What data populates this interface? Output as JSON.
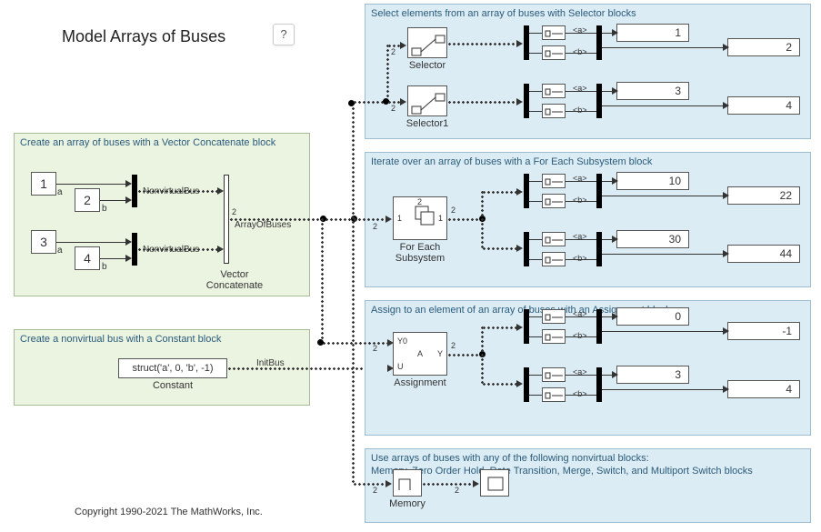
{
  "title": "Model Arrays of Buses",
  "help_label": "?",
  "areas": {
    "create_array": "Create an array of buses with a Vector Concatenate block",
    "create_bus": "Create a nonvirtual bus with a Constant block",
    "select": "Select elements from an array of buses with Selector blocks",
    "iterate": "Iterate over an array of buses with a For Each Subsystem block",
    "assign": "Assign to an element of an array of buses with an Assignment block",
    "other": "Use arrays of buses with any of the following nonvirtual blocks:\nMemory, Zero Order Hold, Rate Transition, Merge, Switch, and Multiport Switch blocks"
  },
  "constants": {
    "c1": "1",
    "c2": "2",
    "c3": "3",
    "c4": "4"
  },
  "port_a": "a",
  "port_b": "b",
  "bus_label_nv": "NonvirtualBus",
  "signal_array": "ArrayOfBuses",
  "signal_init": "InitBus",
  "vec_concat_label": "Vector\nConcatenate",
  "constant_expr": "struct('a', 0, 'b', -1)",
  "constant_label": "Constant",
  "selector_label": "Selector",
  "selector1_label": "Selector1",
  "foreach_label": "For Each\nSubsystem",
  "assignment_label": "Assignment",
  "assignment_ports": {
    "y0": "Y0",
    "u": "U",
    "y": "Y",
    "a": "A"
  },
  "memory_label": "Memory",
  "bus_sel_a": "<a>",
  "bus_sel_b": "<b>",
  "dim1": "1",
  "dim2": "2",
  "displays": {
    "sel": {
      "a": "1",
      "b": "2",
      "a2": "3",
      "b2": "4"
    },
    "iter": {
      "a": "10",
      "b": "22",
      "a2": "30",
      "b2": "44"
    },
    "assign": {
      "a": "0",
      "b": "-1",
      "a2": "3",
      "b2": "4"
    }
  },
  "copyright": "Copyright 1990-2021 The MathWorks, Inc."
}
